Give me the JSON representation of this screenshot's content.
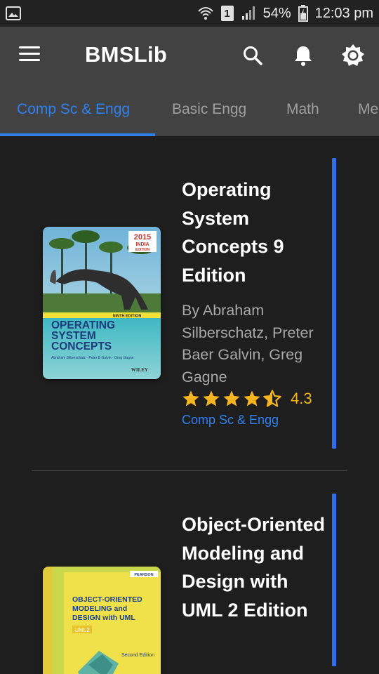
{
  "status_bar": {
    "battery": "54%",
    "time": "12:03 pm",
    "sim_slot": "1",
    "icons": [
      "image-icon",
      "wifi-icon",
      "sim-icon",
      "signal-icon",
      "battery-icon"
    ]
  },
  "app_bar": {
    "title": "BMSLib",
    "actions": [
      "search-icon",
      "bell-icon",
      "brightness-icon"
    ]
  },
  "tabs": [
    {
      "label": "Comp Sc & Engg",
      "active": true
    },
    {
      "label": "Basic Engg",
      "active": false
    },
    {
      "label": "Math",
      "active": false
    },
    {
      "label": "Me",
      "active": false
    }
  ],
  "books": [
    {
      "title": "Operating System Concepts 9 Edition",
      "author": "By Abraham Silberschatz, Preter Baer Galvin, Greg Gagne",
      "rating": "4.3",
      "rating_value": 4.3,
      "category": "Comp Sc & Engg",
      "cover": {
        "badge_year": "2015",
        "badge_line1": "INDIA",
        "badge_line2": "EDITION",
        "edition_strip": "NINTH EDITION",
        "title_lines": [
          "OPERATING",
          "SYSTEM",
          "CONCEPTS"
        ],
        "authors": "Abraham Silberschatz · Peter B Galvin · Greg Gagne",
        "publisher": "WILEY"
      }
    },
    {
      "title": "Object-Oriented Modeling and Design with UML 2 Edition",
      "cover": {
        "publisher": "PEARSON",
        "title_lines": [
          "OBJECT-ORIENTED",
          "MODELING and",
          "DESIGN with UML"
        ],
        "tag": "UML2",
        "edition": "Second Edition"
      }
    }
  ],
  "colors": {
    "accent": "#2f80ed",
    "star": "#f6b51e",
    "background": "#1e1e1e",
    "appbar": "#424242"
  }
}
